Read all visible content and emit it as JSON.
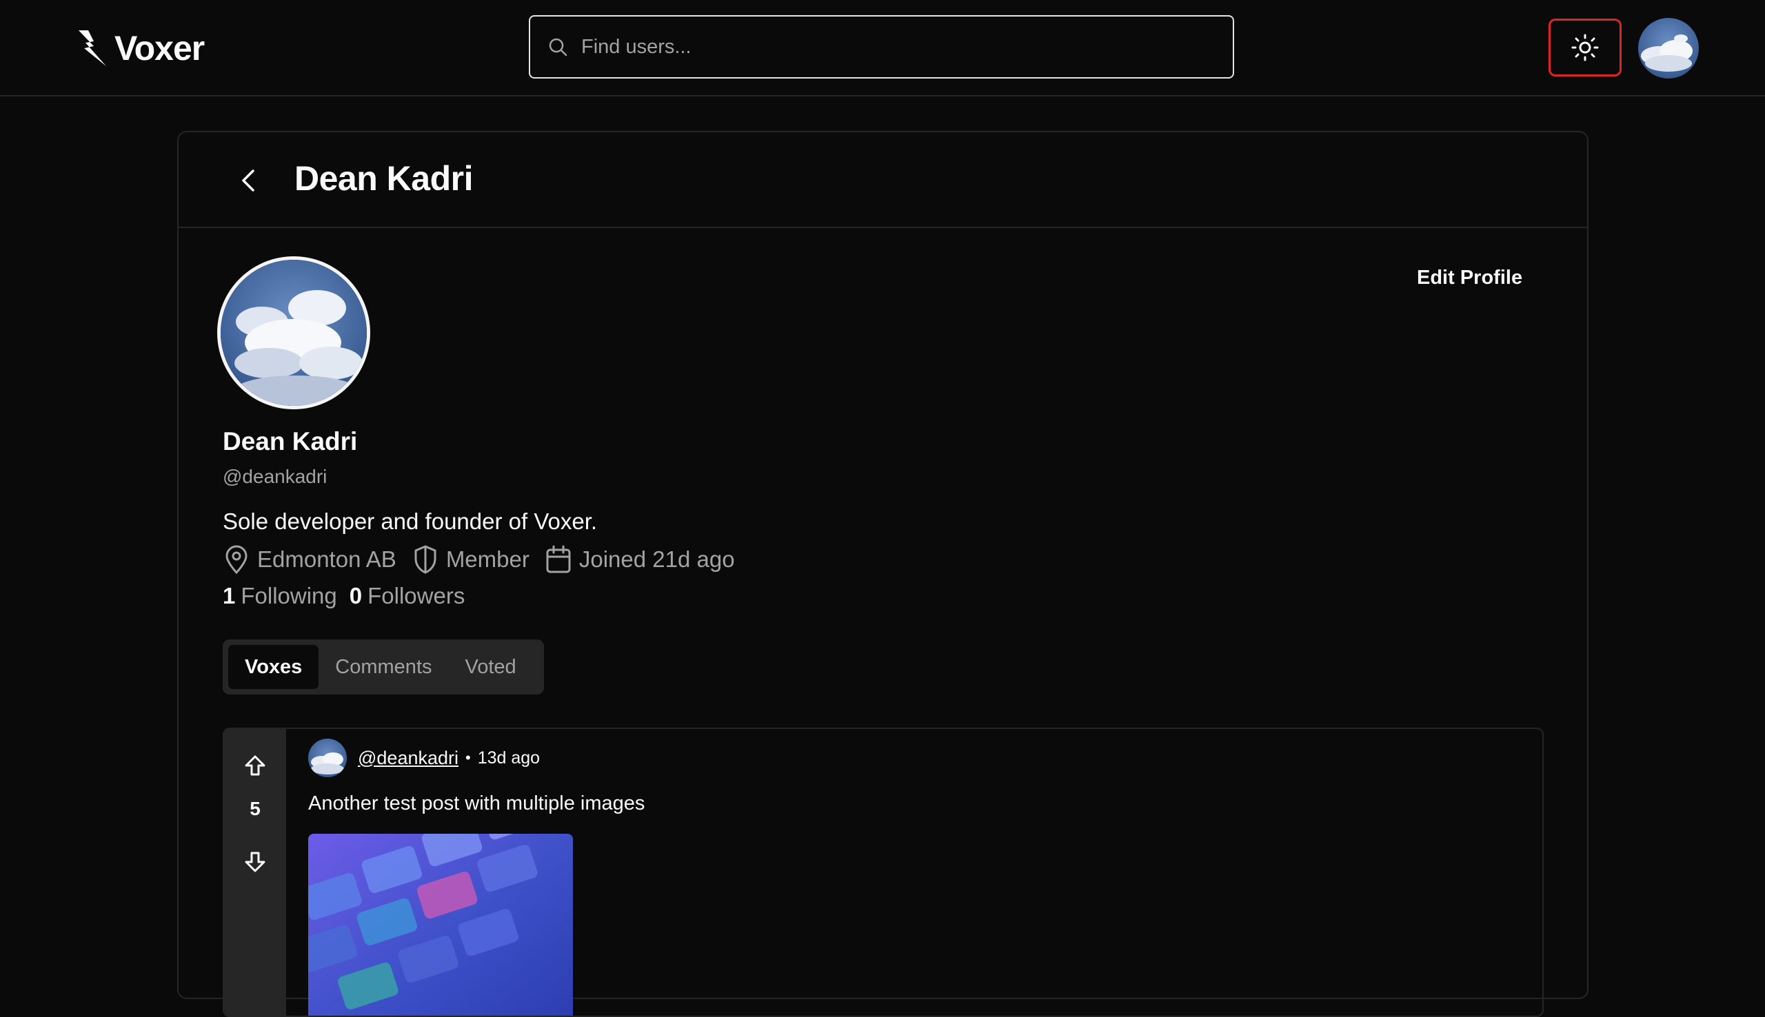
{
  "app": {
    "name": "Voxer"
  },
  "search": {
    "placeholder": "Find users..."
  },
  "colors": {
    "background": "#0a0a0a",
    "border": "#262626",
    "accent_focus": "#dc2626",
    "muted_text": "#a3a3a3"
  },
  "header": {
    "title": "Dean Kadri"
  },
  "profile": {
    "edit_label": "Edit Profile",
    "name": "Dean Kadri",
    "handle": "@deankadri",
    "bio": "Sole developer and founder of Voxer.",
    "location": "Edmonton AB",
    "role": "Member",
    "joined": "Joined 21d ago",
    "following_count": "1",
    "following_label": "Following",
    "followers_count": "0",
    "followers_label": "Followers"
  },
  "tabs": [
    {
      "label": "Voxes",
      "active": true
    },
    {
      "label": "Comments",
      "active": false
    },
    {
      "label": "Voted",
      "active": false
    }
  ],
  "posts": [
    {
      "author": "@deankadri",
      "time": "13d ago",
      "votes": "5",
      "text": "Another test post with multiple images"
    }
  ]
}
